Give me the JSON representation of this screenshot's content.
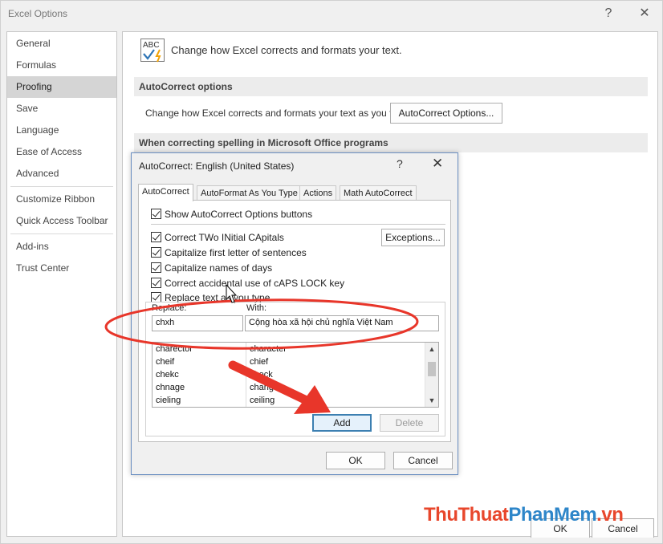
{
  "window": {
    "title": "Excel Options",
    "help_glyph": "?",
    "close_glyph": "✕"
  },
  "sidebar": {
    "groups": [
      [
        "General",
        "Formulas",
        "Proofing",
        "Save",
        "Language",
        "Ease of Access",
        "Advanced"
      ],
      [
        "Customize Ribbon",
        "Quick Access Toolbar"
      ],
      [
        "Add-ins",
        "Trust Center"
      ]
    ],
    "selected": "Proofing"
  },
  "main": {
    "header_icon_text": "ABC",
    "header_text": "Change how Excel corrects and formats your text.",
    "autocorrect_section": "AutoCorrect options",
    "autocorrect_label": "Change how Excel corrects and formats your text as you type:",
    "autocorrect_button": "AutoCorrect Options...",
    "spelling_section": "When correcting spelling in Microsoft Office programs",
    "ok_button": "OK",
    "cancel_button": "Cancel"
  },
  "dialog": {
    "title": "AutoCorrect: English (United States)",
    "help_glyph": "?",
    "close_glyph": "✕",
    "tabs": [
      "AutoCorrect",
      "AutoFormat As You Type",
      "Actions",
      "Math AutoCorrect"
    ],
    "selected_tab": "AutoCorrect",
    "show_buttons": "Show AutoCorrect Options buttons",
    "options": [
      "Correct TWo INitial CApitals",
      "Capitalize first letter of sentences",
      "Capitalize names of days",
      "Correct accidental use of cAPS LOCK key",
      "Replace text as you type"
    ],
    "exceptions_button": "Exceptions...",
    "replace_label": "Replace:",
    "with_label": "With:",
    "replace_value": "chxh",
    "with_value": "Cộng hòa xã hội chủ nghĩa Việt Nam",
    "entries": [
      {
        "replace": "charector",
        "with": "character"
      },
      {
        "replace": "cheif",
        "with": "chief"
      },
      {
        "replace": "chekc",
        "with": "check"
      },
      {
        "replace": "chnage",
        "with": "change"
      },
      {
        "replace": "cieling",
        "with": "ceiling"
      }
    ],
    "add_button": "Add",
    "delete_button": "Delete",
    "ok_button": "OK",
    "cancel_button": "Cancel"
  },
  "colors": {
    "annotation_red": "#e8362a",
    "dialog_border": "#6b8fc2",
    "add_button_border": "#3c7fb1"
  },
  "watermark": {
    "part1": "ThuThuat",
    "part2": "PhanMem",
    "part3": ".vn"
  }
}
